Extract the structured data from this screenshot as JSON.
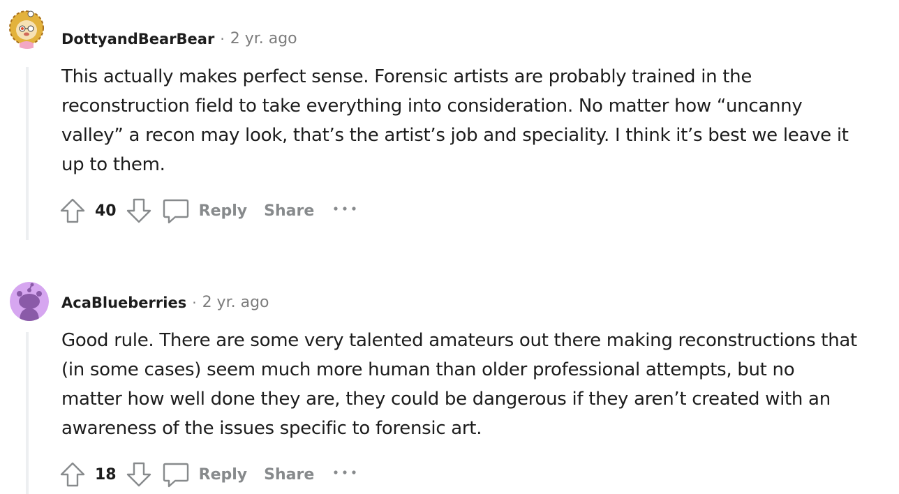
{
  "comments": [
    {
      "author": "DottyandBearBear",
      "separator": "·",
      "time": "2 yr. ago",
      "body": "This actually makes perfect sense. Forensic artists are probably trained in the reconstruction field to take everything into consideration. No matter how “uncanny valley” a recon may look, that’s the artist’s job and speciality. I think it’s best we leave it up to them.",
      "votes": "40",
      "reply_label": "Reply",
      "share_label": "Share",
      "avatar_icon": "lion-avatar-icon"
    },
    {
      "author": "AcaBlueberries",
      "separator": "·",
      "time": "2 yr. ago",
      "body": "Good rule. There are some very talented amateurs out there making reconstructions that (in some cases) seem much more human than older professional attempts, but no matter how well done they are, they could be dangerous if they aren’t created with an awareness of the issues specific to forensic art.",
      "votes": "18",
      "reply_label": "Reply",
      "share_label": "Share",
      "avatar_icon": "snoo-avatar-icon"
    }
  ],
  "colors": {
    "text": "#1c1c1c",
    "meta": "#7c7c7c",
    "action": "#878a8c",
    "thread_line": "#edeff1",
    "avatar2_bg": "#d6a6f0"
  }
}
